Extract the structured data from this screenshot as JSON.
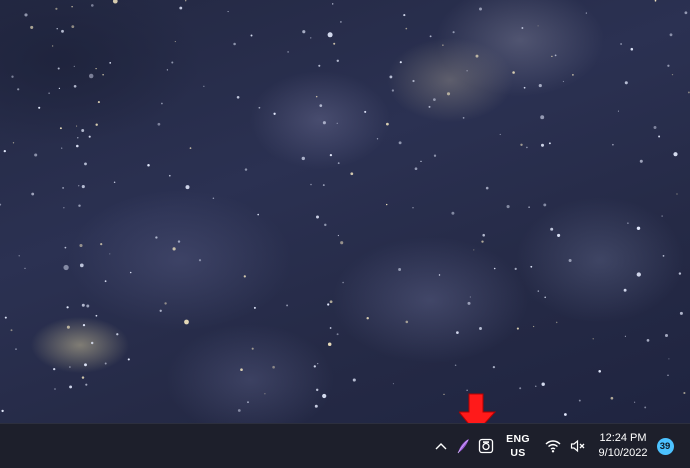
{
  "desktop": {
    "wallpaper": "night-sky-clouds",
    "annotation": {
      "icon": "red-arrow-icon",
      "color": "#ff1a1a"
    }
  },
  "taskbar": {
    "background": "#1d1f2b",
    "tray": {
      "chevron_icon": "chevron-up-icon",
      "app_icon": "purple-feather-icon",
      "camera_icon": "screenshot-camera-icon",
      "language": {
        "line1": "ENG",
        "line2": "US"
      },
      "wifi_icon": "wifi-icon",
      "volume_icon": "speaker-muted-icon"
    },
    "clock": {
      "time": "12:24 PM",
      "date": "9/10/2022"
    },
    "notifications": {
      "count": "39",
      "badge_color": "#4cc2ff"
    }
  }
}
